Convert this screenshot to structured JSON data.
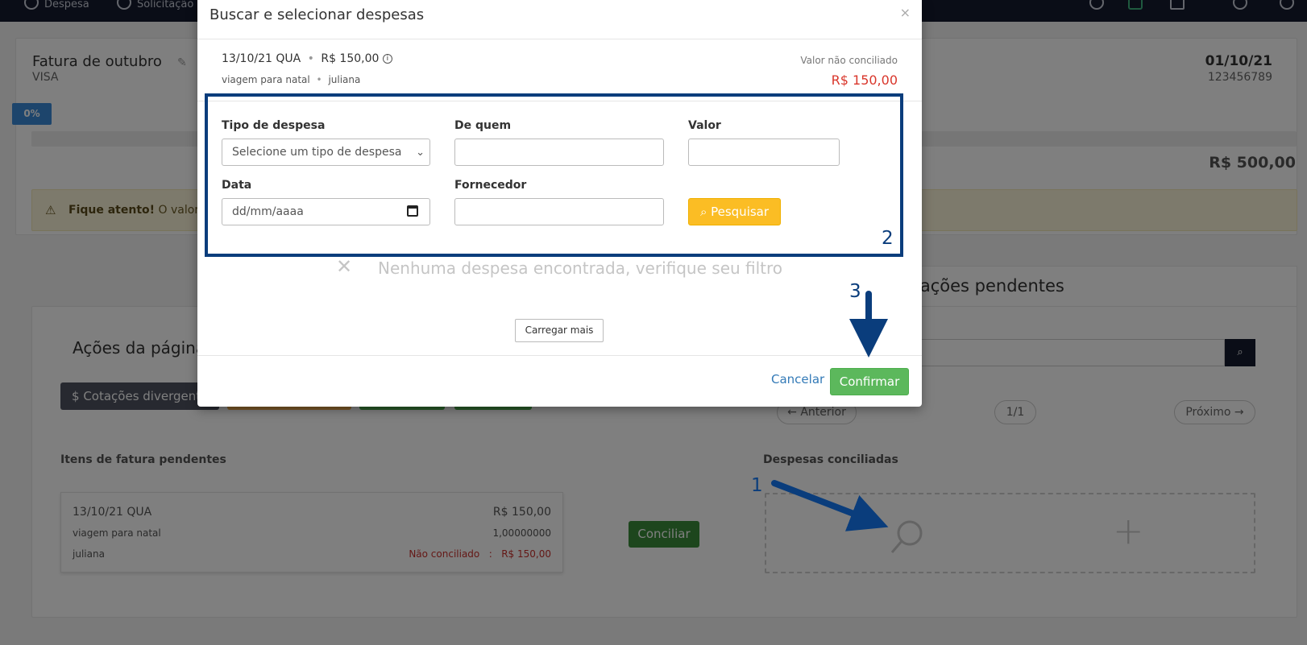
{
  "background": {
    "topbar": {
      "nav_1": "Despesa",
      "nav_2": "Solicitação"
    },
    "invoice": {
      "title": "Fatura de outubro",
      "card_brand": "VISA",
      "date": "01/10/21",
      "number": "123456789",
      "progress_badge": "0%",
      "progress_fraction": 0,
      "total": "R$ 500,00"
    },
    "alert": {
      "bold": "Fique atento!",
      "text": "O valor c"
    },
    "pending_reconciliations_title": "iações pendentes",
    "page_actions_title": "Ações da página",
    "chip_divergent": "Cotações divergentes",
    "pager": {
      "prev": "Anterior",
      "pages": "1/1",
      "next": "Próximo"
    },
    "pending_items_title": "Itens de fatura pendentes",
    "reconciled_title": "Despesas conciliadas",
    "item": {
      "date": "13/10/21 QUA",
      "amount": "R$ 150,00",
      "description": "viagem para natal",
      "rate": "1,00000000",
      "user": "juliana",
      "status": "Não conciliado",
      "status_sep": ":",
      "status_amount": "R$ 150,00"
    },
    "reconcile_button": "Conciliar"
  },
  "modal": {
    "title": "Buscar e selecionar despesas",
    "close": "×",
    "info": {
      "date": "13/10/21 QUA",
      "amount": "R$ 150,00",
      "description": "viagem para natal",
      "user": "juliana",
      "unreconciled_label": "Valor não conciliado",
      "unreconciled_value": "R$ 150,00"
    },
    "filters": {
      "type_label": "Tipo de despesa",
      "type_value": "Selecione um tipo de despesa",
      "from_label": "De quem",
      "from_value": "",
      "value_label": "Valor",
      "value_value": "",
      "date_label": "Data",
      "date_placeholder": "dd/mm/aaaa",
      "supplier_label": "Fornecedor",
      "supplier_value": "",
      "search_button": "Pesquisar"
    },
    "empty_message": "Nenhuma despesa encontrada, verifique seu filtro",
    "load_more": "Carregar mais",
    "cancel": "Cancelar",
    "confirm": "Confirmar"
  },
  "annotations": {
    "one": "1",
    "two": "2",
    "three": "3"
  },
  "colors": {
    "annotation": "#0a3d7c",
    "confirm": "#5cb85c",
    "search": "#fbbd24",
    "alert_red": "#d9362b"
  },
  "icons": [
    "despesa-icon",
    "solicitacao-icon",
    "search-icon",
    "gift-icon",
    "checklist-icon",
    "help-icon",
    "user-icon",
    "pencil-icon",
    "warning-icon",
    "info-icon",
    "calendar-icon",
    "magnifier-icon",
    "cutlery-icon",
    "plus-icon",
    "close-icon",
    "chevron-down-icon"
  ]
}
